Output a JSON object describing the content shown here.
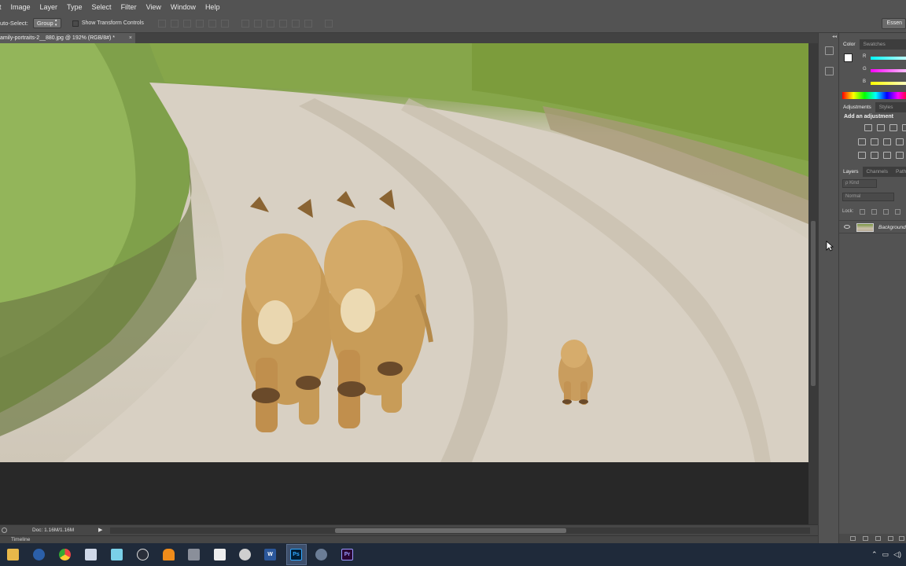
{
  "menubar": {
    "items": [
      "it",
      "Image",
      "Layer",
      "Type",
      "Select",
      "Filter",
      "View",
      "Window",
      "Help"
    ]
  },
  "options": {
    "autoselect_label": "uto-Select:",
    "autoselect_value": "Group",
    "transform_label": "Show Transform Controls",
    "workspace_button": "Essen"
  },
  "document": {
    "tab_title": "amily-portraits-2__880.jpg @ 192% (RGB/8#) *",
    "close_glyph": "×"
  },
  "status": {
    "doc_size": "Doc: 1.16M/1.16M",
    "arrow": "▶",
    "timeline": "Timeline"
  },
  "panels": {
    "color_tabs": [
      "Color",
      "Swatches"
    ],
    "rgb_labels": [
      "R",
      "G",
      "B"
    ],
    "adjustment_tabs": [
      "Adjustments",
      "Styles"
    ],
    "add_adjustment": "Add an adjustment",
    "layer_tabs": [
      "Layers",
      "Channels",
      "Paths"
    ],
    "kind_placeholder": "ρ Kind",
    "blend_mode": "Normal",
    "lock_label": "Lock:",
    "layer_name": "Background"
  },
  "taskbar": {
    "icons": [
      "file-explorer-icon",
      "steam-icon",
      "chrome-icon",
      "notepad-icon",
      "app-icon",
      "media-icon",
      "vlc-icon",
      "settings-icon",
      "calculator-icon",
      "chrome-alt-icon",
      "word-icon",
      "photoshop-icon",
      "paint-icon",
      "premiere-icon"
    ],
    "word_letter": "W",
    "ps_label": "Ps",
    "pr_label": "Pr"
  },
  "colors": {
    "ui_bg": "#535353",
    "canvas_bg": "#282828",
    "taskbar_bg": "#1f2a3a",
    "ps_blue": "#31a8ff",
    "pr_purple": "#9999ff"
  }
}
